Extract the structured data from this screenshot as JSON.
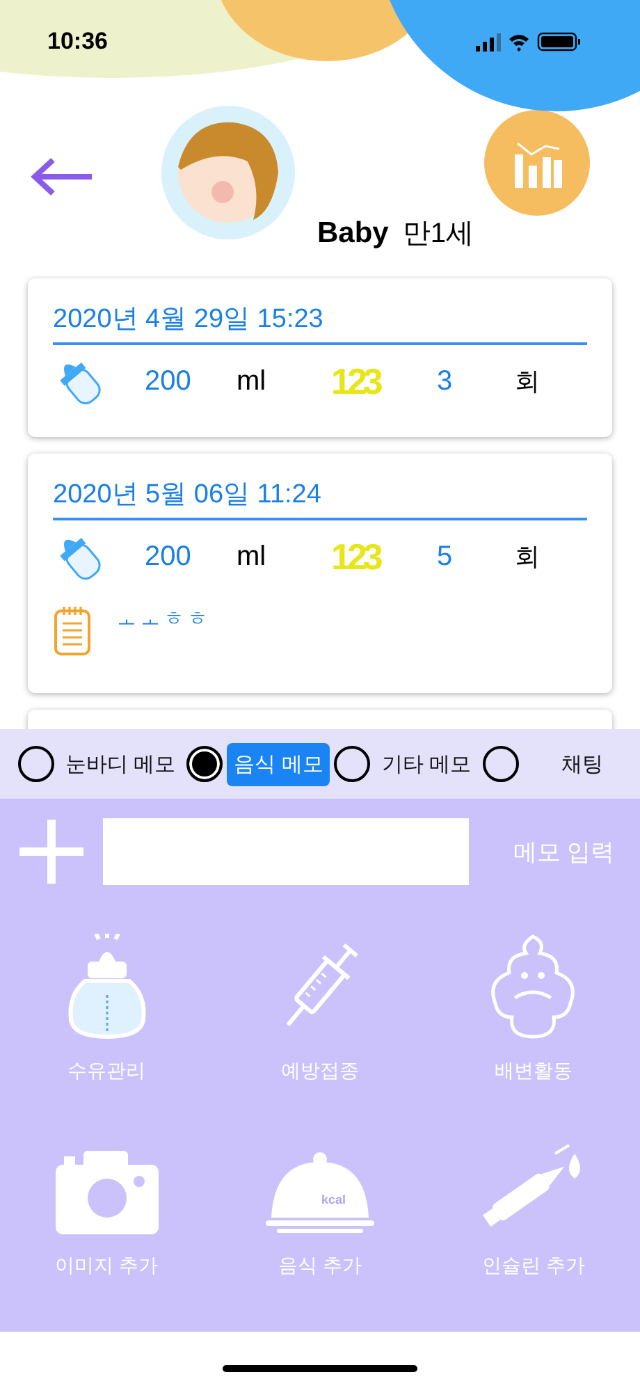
{
  "status_bar": {
    "time": "10:36"
  },
  "profile": {
    "name": "Baby",
    "age": "만1세"
  },
  "records": [
    {
      "date": "2020년 4월 29일 15:23",
      "amount": "200",
      "amount_unit": "ml",
      "count_icon": "123",
      "count": "3",
      "count_unit": "회"
    },
    {
      "date": "2020년 5월 06일 11:24",
      "amount": "200",
      "amount_unit": "ml",
      "count_icon": "123",
      "count": "5",
      "count_unit": "회",
      "memo": "ㅗㅗㅎㅎ"
    }
  ],
  "memo_types": [
    {
      "label": "눈바디 메모",
      "selected": false
    },
    {
      "label": "음식 메모",
      "selected": true
    },
    {
      "label": "기타 메모",
      "selected": false
    },
    {
      "label": "채팅",
      "selected": false
    }
  ],
  "memo_input": {
    "button": "메모 입력"
  },
  "actions": [
    {
      "kind": "bottle",
      "label": "수유관리"
    },
    {
      "kind": "syringe",
      "label": "예방접종"
    },
    {
      "kind": "poop",
      "label": "배변활동"
    },
    {
      "kind": "camera",
      "label": "이미지 추가"
    },
    {
      "kind": "cloche",
      "label": "음식 추가",
      "badge": "kcal"
    },
    {
      "kind": "insulin",
      "label": "인슐린 추가"
    }
  ]
}
